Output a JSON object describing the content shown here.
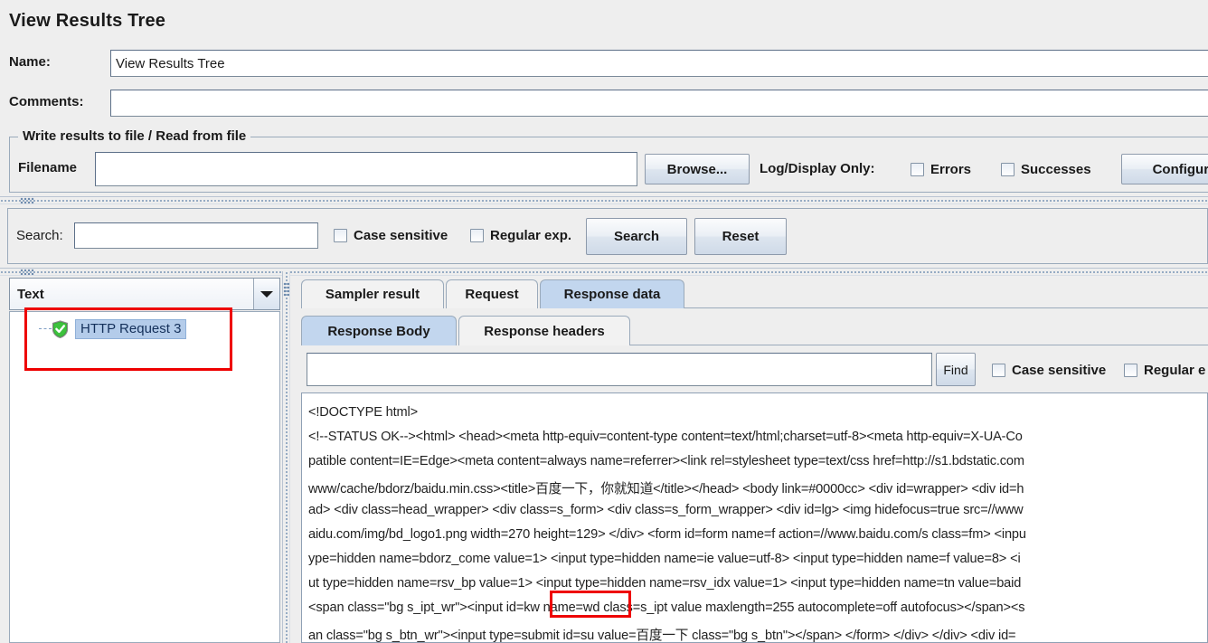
{
  "window": {
    "title": "View Results Tree"
  },
  "form": {
    "name_label": "Name:",
    "name_value": "View Results Tree",
    "comments_label": "Comments:",
    "comments_value": ""
  },
  "file_group": {
    "title": "Write results to file / Read from file",
    "filename_label": "Filename",
    "filename_value": "",
    "browse_label": "Browse...",
    "log_display_label": "Log/Display Only:",
    "errors_label": "Errors",
    "successes_label": "Successes",
    "configure_label": "Configure"
  },
  "search_bar": {
    "search_label": "Search:",
    "search_value": "",
    "case_sensitive_label": "Case sensitive",
    "regular_exp_label": "Regular exp.",
    "search_button": "Search",
    "reset_button": "Reset"
  },
  "tree_panel": {
    "render_selector_value": "Text",
    "nodes": [
      {
        "label": "HTTP Request 3",
        "status_icon": "green-shield-check-icon",
        "selected": true
      }
    ]
  },
  "result_tabs": {
    "items": [
      {
        "label": "Sampler result",
        "active": false
      },
      {
        "label": "Request",
        "active": false
      },
      {
        "label": "Response data",
        "active": true
      }
    ]
  },
  "response_tabs": {
    "items": [
      {
        "label": "Response Body",
        "active": true
      },
      {
        "label": "Response headers",
        "active": false
      }
    ]
  },
  "find_bar": {
    "find_value": "",
    "find_button": "Find",
    "case_sensitive_label": "Case sensitive",
    "regular_exp_label": "Regular e"
  },
  "response_body": {
    "lines": [
      "<!DOCTYPE html>",
      "<!--STATUS OK--><html> <head><meta http-equiv=content-type content=text/html;charset=utf-8><meta http-equiv=X-UA-Co",
      "patible content=IE=Edge><meta content=always name=referrer><link rel=stylesheet type=text/css href=http://s1.bdstatic.com",
      "www/cache/bdorz/baidu.min.css><title>百度一下，你就知道</title></head> <body link=#0000cc> <div id=wrapper> <div id=h",
      "ad> <div class=head_wrapper> <div class=s_form> <div class=s_form_wrapper> <div id=lg> <img hidefocus=true src=//www",
      "aidu.com/img/bd_logo1.png width=270 height=129> </div> <form id=form name=f action=//www.baidu.com/s class=fm> <inpu",
      "ype=hidden name=bdorz_come value=1> <input type=hidden name=ie value=utf-8> <input type=hidden name=f value=8> <i",
      "ut type=hidden name=rsv_bp value=1> <input type=hidden name=rsv_idx value=1> <input type=hidden name=tn value=baid",
      "<span class=\"bg s_ipt_wr\"><input id=kw name=wd class=s_ipt value maxlength=255 autocomplete=off autofocus></span><s",
      "an class=\"bg s_btn_wr\"><input type=submit id=su value=百度一下 class=\"bg s_btn\"></span> </form> </div> </div> <div id="
    ]
  },
  "annotations": [
    {
      "name": "tree-node-highlight",
      "color": "#ee0000"
    },
    {
      "name": "kw-input-highlight",
      "color": "#ee0000"
    }
  ]
}
